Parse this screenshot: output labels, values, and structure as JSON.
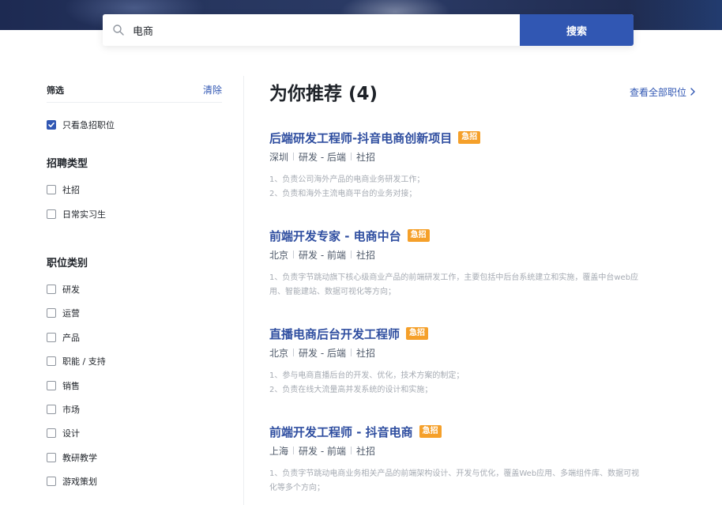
{
  "search": {
    "value": "电商",
    "button_label": "搜索"
  },
  "sidebar": {
    "filter_title": "筛选",
    "clear_label": "清除",
    "urgent_only_label": "只看急招职位",
    "recruit_type": {
      "title": "招聘类型",
      "options": [
        "社招",
        "日常实习生"
      ]
    },
    "job_category": {
      "title": "职位类别",
      "options": [
        "研发",
        "运营",
        "产品",
        "职能 / 支持",
        "销售",
        "市场",
        "设计",
        "教研教学",
        "游戏策划"
      ]
    }
  },
  "main": {
    "title": "为你推荐 (4)",
    "view_all_label": "查看全部职位",
    "jobs": [
      {
        "title": "后端研发工程师-抖音电商创新项目",
        "badge": "急招",
        "city": "深圳",
        "category": "研发 - 后端",
        "type": "社招",
        "desc": [
          "1、负责公司海外产品的电商业务研发工作；",
          "2、负责和海外主流电商平台的业务对接；"
        ]
      },
      {
        "title": "前端开发专家 - 电商中台",
        "badge": "急招",
        "city": "北京",
        "category": "研发 - 前端",
        "type": "社招",
        "desc": [
          "1、负责字节跳动旗下核心级商业产品的前端研发工作，主要包括中后台系统建立和实施，覆盖中台web应",
          "用、智能建站、数据可视化等方向；"
        ]
      },
      {
        "title": "直播电商后台开发工程师",
        "badge": "急招",
        "city": "北京",
        "category": "研发 - 后端",
        "type": "社招",
        "desc": [
          "1、参与电商直播后台的开发、优化，技术方案的制定；",
          "2、负责在线大流量高并发系统的设计和实施；"
        ]
      },
      {
        "title": "前端开发工程师 - 抖音电商",
        "badge": "急招",
        "city": "上海",
        "category": "研发 - 前端",
        "type": "社招",
        "desc": [
          "1、负责字节跳动电商业务相关产品的前端架构设计、开发与优化，覆盖Web应用、多端组件库、数据可视",
          "化等多个方向；"
        ]
      }
    ]
  },
  "colors": {
    "brand": "#3157b3",
    "job_title": "#2f4ea0",
    "urgent_badge": "#f5a02a"
  }
}
